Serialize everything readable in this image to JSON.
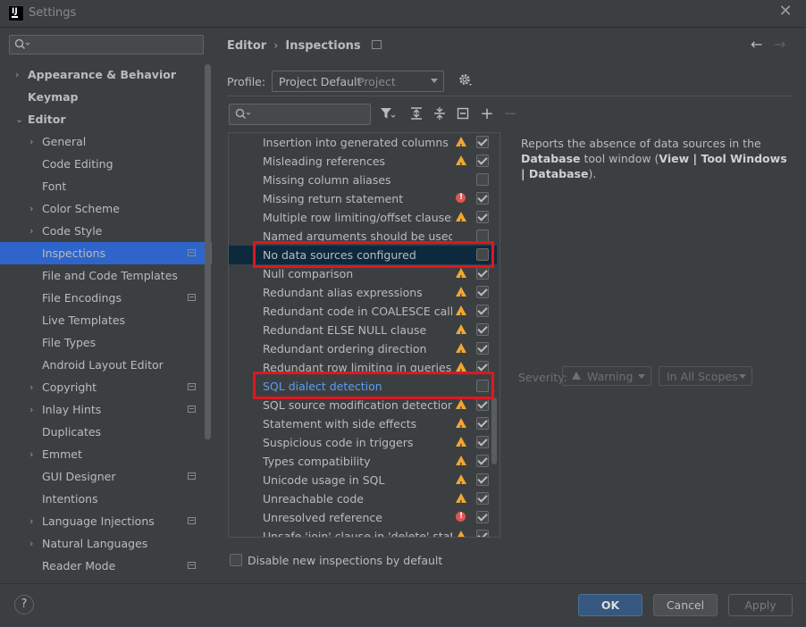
{
  "window": {
    "title": "Settings",
    "close_glyph": "✕",
    "logo_text": "IJ"
  },
  "sidebar": {
    "search_placeholder": "",
    "items": [
      {
        "label": "Appearance & Behavior",
        "bold": true,
        "arrow": "›",
        "level": 0
      },
      {
        "label": "Keymap",
        "bold": true,
        "arrow": "",
        "level": 0
      },
      {
        "label": "Editor",
        "bold": true,
        "arrow": "⌄",
        "level": 0
      },
      {
        "label": "General",
        "arrow": "›",
        "level": 1
      },
      {
        "label": "Code Editing",
        "arrow": "",
        "level": 1
      },
      {
        "label": "Font",
        "arrow": "",
        "level": 1
      },
      {
        "label": "Color Scheme",
        "arrow": "›",
        "level": 1
      },
      {
        "label": "Code Style",
        "arrow": "›",
        "level": 1
      },
      {
        "label": "Inspections",
        "arrow": "",
        "level": 1,
        "selected": true,
        "project": true
      },
      {
        "label": "File and Code Templates",
        "arrow": "",
        "level": 1
      },
      {
        "label": "File Encodings",
        "arrow": "",
        "level": 1,
        "project": true
      },
      {
        "label": "Live Templates",
        "arrow": "",
        "level": 1
      },
      {
        "label": "File Types",
        "arrow": "",
        "level": 1
      },
      {
        "label": "Android Layout Editor",
        "arrow": "",
        "level": 1
      },
      {
        "label": "Copyright",
        "arrow": "›",
        "level": 1,
        "project": true
      },
      {
        "label": "Inlay Hints",
        "arrow": "›",
        "level": 1,
        "project": true
      },
      {
        "label": "Duplicates",
        "arrow": "",
        "level": 1
      },
      {
        "label": "Emmet",
        "arrow": "›",
        "level": 1
      },
      {
        "label": "GUI Designer",
        "arrow": "",
        "level": 1,
        "project": true
      },
      {
        "label": "Intentions",
        "arrow": "",
        "level": 1
      },
      {
        "label": "Language Injections",
        "arrow": "›",
        "level": 1,
        "project": true
      },
      {
        "label": "Natural Languages",
        "arrow": "›",
        "level": 1
      },
      {
        "label": "Reader Mode",
        "arrow": "",
        "level": 1,
        "project": true
      }
    ]
  },
  "breadcrumb": {
    "part1": "Editor",
    "separator": "›",
    "part2": "Inspections"
  },
  "nav": {
    "back": "←",
    "forward": "→"
  },
  "profile": {
    "label": "Profile:",
    "value": "Project Default",
    "scope": "Project"
  },
  "toolbar": {
    "filter": "⏷",
    "expand": "⇞",
    "collapse": "⇟",
    "reset": "⊟",
    "add": "+",
    "remove": "−"
  },
  "inspections": [
    {
      "name": "Insertion into generated columns",
      "severity": "warn",
      "checked": true
    },
    {
      "name": "Misleading references",
      "severity": "warn",
      "checked": true
    },
    {
      "name": "Missing column aliases",
      "severity": "",
      "checked": false
    },
    {
      "name": "Missing return statement",
      "severity": "err",
      "checked": true
    },
    {
      "name": "Multiple row limiting/offset clauses in q",
      "severity": "warn",
      "checked": true
    },
    {
      "name": "Named arguments should be used",
      "severity": "",
      "checked": false
    },
    {
      "name": "No data sources configured",
      "severity": "",
      "checked": false,
      "selected": true
    },
    {
      "name": "Null comparison",
      "severity": "warn",
      "checked": true
    },
    {
      "name": "Redundant alias expressions",
      "severity": "warn",
      "checked": true
    },
    {
      "name": "Redundant code in COALESCE call",
      "severity": "warn",
      "checked": true
    },
    {
      "name": "Redundant ELSE NULL clause",
      "severity": "warn",
      "checked": true
    },
    {
      "name": "Redundant ordering direction",
      "severity": "warn",
      "checked": true
    },
    {
      "name": "Redundant row limiting in queries",
      "severity": "warn",
      "checked": true
    },
    {
      "name": "SQL dialect detection",
      "severity": "",
      "checked": false,
      "link": true
    },
    {
      "name": "SQL source modification detection",
      "severity": "warn",
      "checked": true
    },
    {
      "name": "Statement with side effects",
      "severity": "warn",
      "checked": true
    },
    {
      "name": "Suspicious code in triggers",
      "severity": "warn",
      "checked": true
    },
    {
      "name": "Types compatibility",
      "severity": "warn",
      "checked": true
    },
    {
      "name": "Unicode usage in SQL",
      "severity": "warn",
      "checked": true
    },
    {
      "name": "Unreachable code",
      "severity": "warn",
      "checked": true
    },
    {
      "name": "Unresolved reference",
      "severity": "err",
      "checked": true
    },
    {
      "name": "Unsafe 'join' clause in 'delete' statement",
      "severity": "warn",
      "checked": true
    }
  ],
  "description": {
    "text1": "Reports the absence of data sources in the ",
    "bold1": "Database",
    "text2": " tool window (",
    "bold2": "View | Tool Windows | Database",
    "text3": ")."
  },
  "severity": {
    "label": "Severity:",
    "value": "Warning",
    "scope": "In All Scopes"
  },
  "disable_new": {
    "label": "Disable new inspections by default",
    "checked": false
  },
  "buttons": {
    "help": "?",
    "ok": "OK",
    "cancel": "Cancel",
    "apply": "Apply"
  },
  "colors": {
    "accent": "#2f65ca",
    "highlight": "#e0161f",
    "link": "#589df6",
    "warning": "#f0a732",
    "error": "#e05555"
  }
}
